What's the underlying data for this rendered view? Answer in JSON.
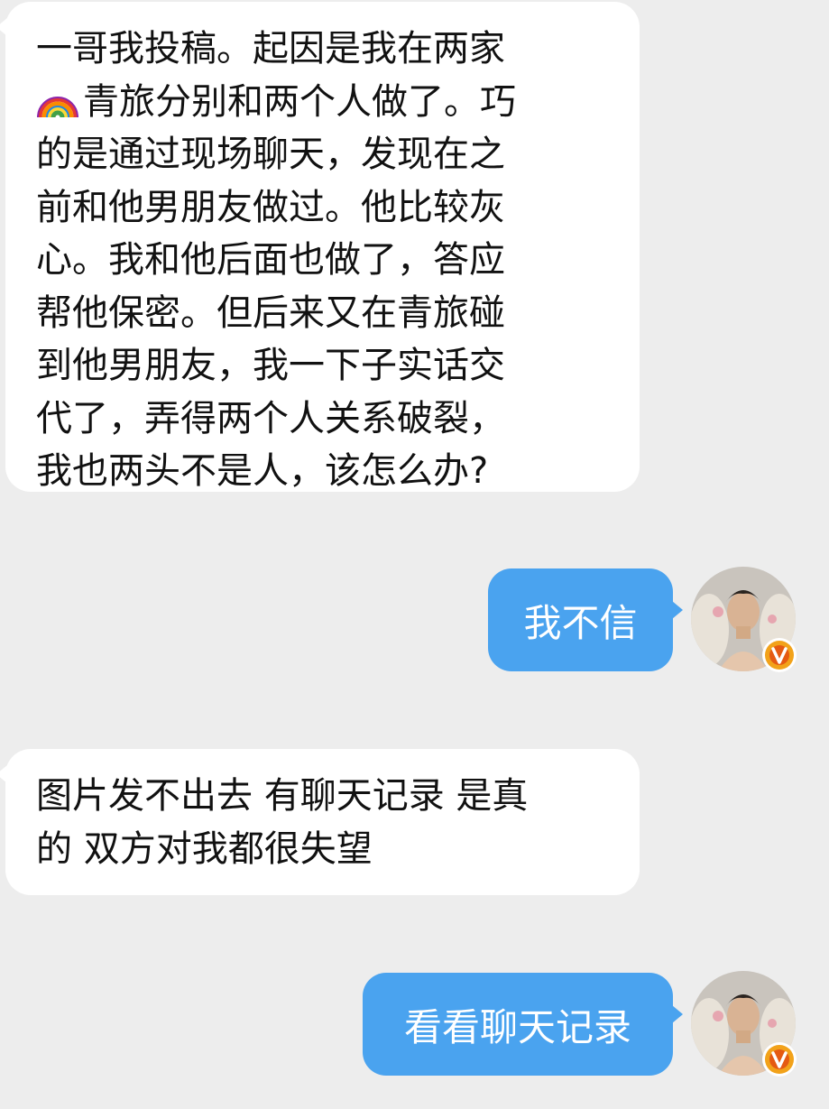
{
  "messages": [
    {
      "sender": "other",
      "lines": [
        "一哥我投稿。起因是我在两家",
        "青旅分别和两个人做了。巧",
        "的是通过现场聊天，发现在之",
        "前和他男朋友做过。他比较灰",
        "心。我和他后面也做了，答应",
        "帮他保密。但后来又在青旅碰",
        "到他男朋友，我一下子实话交",
        "代了，弄得两个人关系破裂，",
        "我也两头不是人，该怎么办?"
      ],
      "inline_icon": "rainbow-emoji"
    },
    {
      "sender": "self",
      "text": "我不信",
      "avatar_badge": "verified-v-badge"
    },
    {
      "sender": "other",
      "lines": [
        "图片发不出去 有聊天记录 是真",
        "的 双方对我都很失望"
      ]
    },
    {
      "sender": "self",
      "text": "看看聊天记录",
      "avatar_badge": "verified-v-badge"
    }
  ],
  "colors": {
    "background": "#ededed",
    "incoming_bubble": "#ffffff",
    "outgoing_bubble": "#4aa3ef",
    "incoming_text": "#111111",
    "outgoing_text": "#ffffff",
    "badge": "#f2a21a"
  }
}
